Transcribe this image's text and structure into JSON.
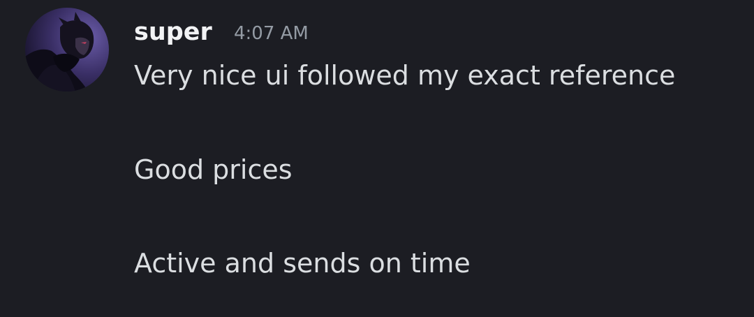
{
  "message": {
    "author": "super",
    "timestamp": "4:07 AM",
    "avatar_icon": "user-avatar",
    "lines": [
      "Very nice ui followed my exact reference",
      "Good prices",
      "Active and sends on time"
    ]
  },
  "colors": {
    "background": "#1c1d23",
    "username": "#f2f3f5",
    "timestamp": "#949ba4",
    "message_text": "#dbdee1"
  }
}
